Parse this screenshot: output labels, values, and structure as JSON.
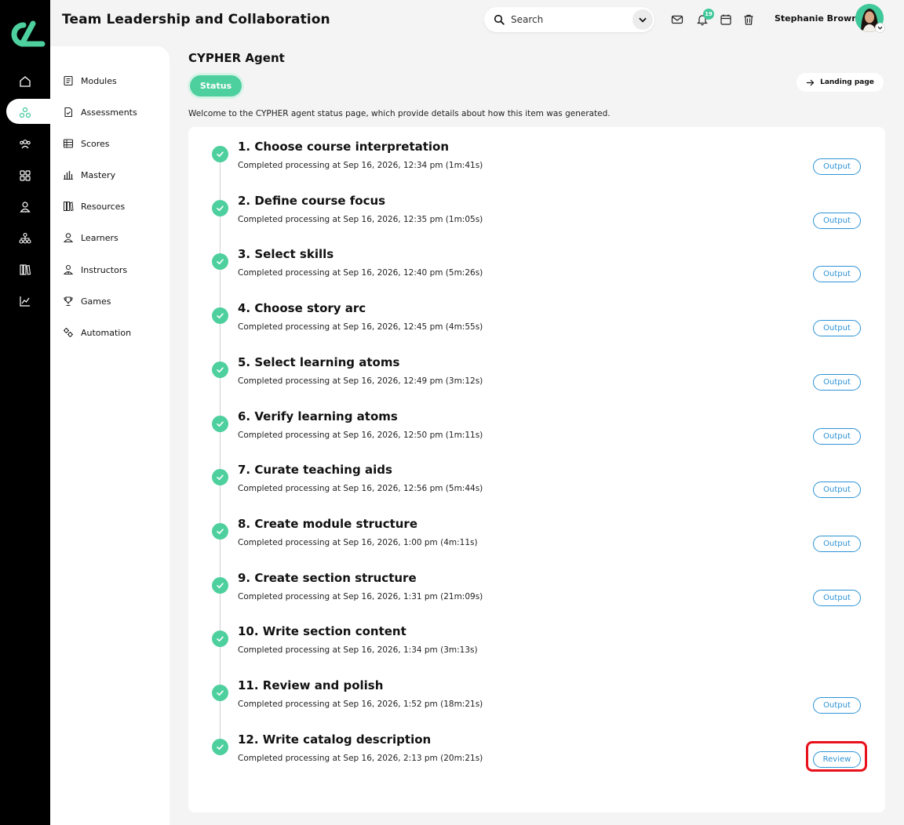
{
  "app": {
    "title": "Team Leadership and Collaboration"
  },
  "header": {
    "search_label": "Search",
    "notification_count": "19",
    "user_name": "Stephanie Brown"
  },
  "rail": {
    "icons": [
      "home-icon",
      "network-icon",
      "group-icon",
      "grid-icon",
      "person-icon",
      "hierarchy-icon",
      "library-icon",
      "chart-icon"
    ],
    "active_index": 1
  },
  "sidebar": {
    "items": [
      {
        "label": "Modules",
        "icon": "modules-icon"
      },
      {
        "label": "Assessments",
        "icon": "assessments-icon"
      },
      {
        "label": "Scores",
        "icon": "scores-icon"
      },
      {
        "label": "Mastery",
        "icon": "mastery-icon"
      },
      {
        "label": "Resources",
        "icon": "resources-icon"
      },
      {
        "label": "Learners",
        "icon": "learners-icon"
      },
      {
        "label": "Instructors",
        "icon": "instructors-icon"
      },
      {
        "label": "Games",
        "icon": "trophy-icon"
      },
      {
        "label": "Automation",
        "icon": "gears-icon"
      }
    ]
  },
  "main": {
    "title": "CYPHER Agent",
    "status_label": "Status",
    "landing_label": "Landing page",
    "intro": "Welcome to the CYPHER agent status page, which provide details about how this item was generated.",
    "steps": [
      {
        "title": "1. Choose course interpretation",
        "detail": "Completed processing at Sep 16, 2026, 12:34 pm (1m:41s)",
        "action": "Output"
      },
      {
        "title": "2. Define course focus",
        "detail": "Completed processing at Sep 16, 2026, 12:35 pm (1m:05s)",
        "action": "Output"
      },
      {
        "title": "3. Select skills",
        "detail": "Completed processing at Sep 16, 2026, 12:40 pm (5m:26s)",
        "action": "Output"
      },
      {
        "title": "4. Choose story arc",
        "detail": "Completed processing at Sep 16, 2026, 12:45 pm (4m:55s)",
        "action": "Output"
      },
      {
        "title": "5. Select learning atoms",
        "detail": "Completed processing at Sep 16, 2026, 12:49 pm (3m:12s)",
        "action": "Output"
      },
      {
        "title": "6. Verify learning atoms",
        "detail": "Completed processing at Sep 16, 2026, 12:50 pm (1m:11s)",
        "action": "Output"
      },
      {
        "title": "7. Curate teaching aids",
        "detail": "Completed processing at Sep 16, 2026, 12:56 pm (5m:44s)",
        "action": "Output"
      },
      {
        "title": "8. Create module structure",
        "detail": "Completed processing at Sep 16, 2026, 1:00 pm (4m:11s)",
        "action": "Output"
      },
      {
        "title": "9. Create section structure",
        "detail": "Completed processing at Sep 16, 2026, 1:31 pm (21m:09s)",
        "action": "Output"
      },
      {
        "title": "10. Write section content",
        "detail": "Completed processing at Sep 16, 2026, 1:34 pm (3m:13s)",
        "action": ""
      },
      {
        "title": "11. Review and polish",
        "detail": "Completed processing at Sep 16, 2026, 1:52 pm (18m:21s)",
        "action": "Output"
      },
      {
        "title": "12. Write catalog description",
        "detail": "Completed processing at Sep 16, 2026, 2:13 pm (20m:21s)",
        "action": "Review"
      }
    ]
  },
  "colors": {
    "accent": "#4ecf9e",
    "link": "#2c93d6",
    "highlight": "#e8111b"
  }
}
